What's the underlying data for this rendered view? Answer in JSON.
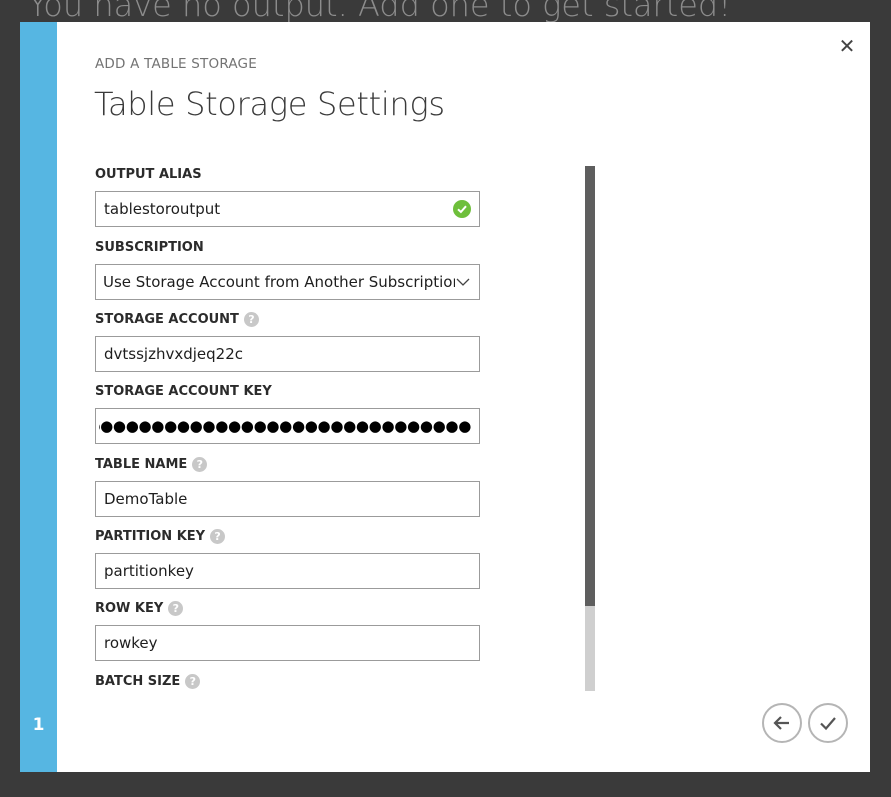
{
  "background": {
    "text": "You have no output. Add one to get started!"
  },
  "dialog": {
    "step_number": "1",
    "eyebrow": "ADD A TABLE STORAGE",
    "title": "Table Storage Settings",
    "close_icon": "close-icon",
    "accent_color": "#56b6e2"
  },
  "form": {
    "output_alias": {
      "label": "OUTPUT ALIAS",
      "value": "tablestoroutput",
      "valid": true
    },
    "subscription": {
      "label": "SUBSCRIPTION",
      "value": "Use Storage Account from Another Subscription"
    },
    "storage_account": {
      "label": "STORAGE ACCOUNT",
      "value": "dvtssjzhvxdjeq22c"
    },
    "storage_account_key": {
      "label": "STORAGE ACCOUNT KEY",
      "value": "●●●●●●●●●●●●●●●●●●●●●●●●●●●●●●●●●●●●●●●●●●●●●"
    },
    "table_name": {
      "label": "TABLE NAME",
      "value": "DemoTable"
    },
    "partition_key": {
      "label": "PARTITION KEY",
      "value": "partitionkey"
    },
    "row_key": {
      "label": "ROW KEY",
      "value": "rowkey"
    },
    "batch_size": {
      "label": "BATCH SIZE"
    },
    "help_glyph": "?"
  },
  "footer": {
    "back_icon": "arrow-left-icon",
    "confirm_icon": "checkmark-icon"
  }
}
